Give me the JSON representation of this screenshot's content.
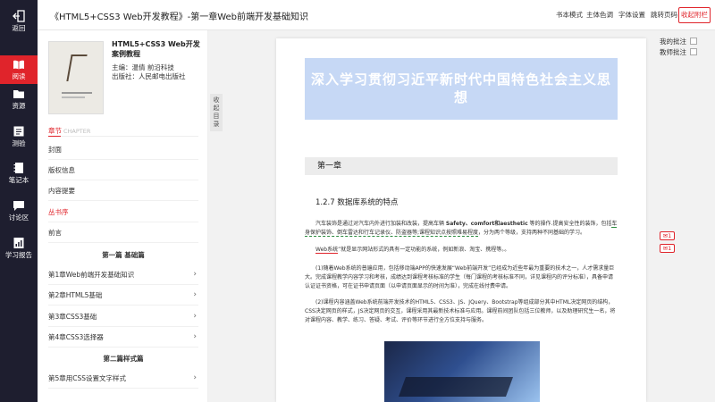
{
  "rail": {
    "items": [
      {
        "label": "返回",
        "icon": "back-icon"
      },
      {
        "label": "阅读",
        "icon": "book-open-icon"
      },
      {
        "label": "资源",
        "icon": "folder-icon"
      },
      {
        "label": "测验",
        "icon": "quiz-icon"
      },
      {
        "label": "笔记本",
        "icon": "notebook-icon"
      },
      {
        "label": "讨论区",
        "icon": "chat-icon"
      },
      {
        "label": "学习报告",
        "icon": "report-icon"
      }
    ]
  },
  "topbar": {
    "title": "《HTML5+CSS3 Web开发教程》-第一章Web前端开发基础知识",
    "buttons": [
      "书本模式",
      "主体色调",
      "字体设置",
      "跳转页码"
    ],
    "exit": "收起附栏"
  },
  "book": {
    "title": "HTML5+CSS3 Web开发案例教程",
    "editor": "主编：温倩 前沿科技",
    "publisher": "出版社：人民邮电出版社"
  },
  "catalog": {
    "section_cn": "章节",
    "section_en": "CHAPTER",
    "items": [
      "封面",
      "版权信息",
      "内容提要",
      "丛书序",
      "前言"
    ],
    "part1": "第一篇 基础篇",
    "chapters1": [
      "第1章Web前端开发基础知识",
      "第2章HTML5基础",
      "第3章CSS3基础",
      "第4章CSS3选择器"
    ],
    "part2": "第二篇样式篇",
    "chapters2": [
      "第5章用CSS设置文字样式"
    ]
  },
  "collapse": "收起目录",
  "reader": {
    "banner": "深入学习贯彻习近平新时代中国特色社会主义思想",
    "chapter": "第一章",
    "subsection": "1.2.7  数据库系统的特点",
    "p1_a": "汽车装饰是通过对汽车内外进行加装和改装，提高车辆 ",
    "p1_b": "Safety、comfort和aesthetic",
    "p1_c": " 等的操作.提高安全性的装饰，包括",
    "p1_d": "车身保护装饰、倒车雷达和行车记录仪、防盗器等;课程知识点按照难易程度",
    "p1_e": "，分为两个等级，支持两种不同基础的学习。",
    "p2_a": "Web系统",
    "p2_b": "”就是显示网站形式的具有一定功能的系统，例如新浪、淘宝、携程等。。",
    "p3": "(1)随着Web系统的普遍应用，包括移动端APP的快速发展“Web前端开发”已经成为近些年最为重要的技术之一，人才需求量巨大。完成课程教学内容学习和考核，成绩达到课程考核标准的学生（每门课程的考核标准不同，详见课程内的评分标准），具备申请认证证书资格，可在证书申请页面（以申请页面显示的时间为准），完成在线付费申请。",
    "p4": "(2)课程内容涵盖Web系统前端开发技术的HTML5、CSS3、JS、JQuery、Bootstrap等组成部分其中HTML决定网页的结构，CSS决定网页的样式，JS决定网页的交互，课程采用其最新技术标准与应用。课程前间团队包括三位教师，以及助理研究生一名，将对课程内容、教学、练习、答疑、考试、评价等环节进行全方位支持与服务。"
  },
  "side": {
    "my_notes": "我的批注",
    "teacher_notes": "教师批注",
    "badge1": "1",
    "badge2": "1"
  }
}
